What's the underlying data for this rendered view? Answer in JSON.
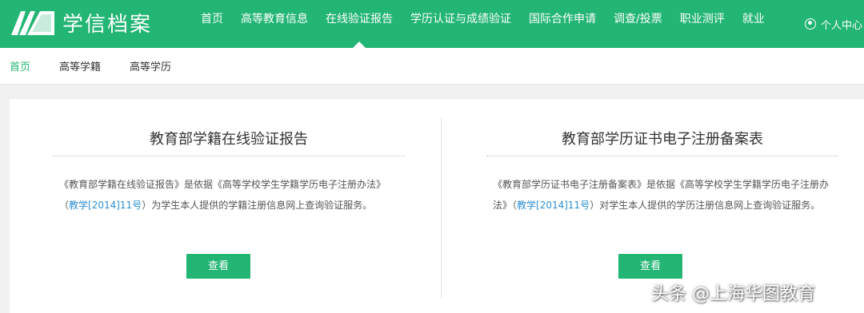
{
  "brand": {
    "name": "学信档案",
    "logo_icon": "book-logo-icon",
    "color": "#22b573"
  },
  "nav": {
    "items": [
      {
        "label": "首页"
      },
      {
        "label": "高等教育信息"
      },
      {
        "label": "在线验证报告",
        "active": true
      },
      {
        "label": "学历认证与成绩验证"
      },
      {
        "label": "国际合作申请"
      },
      {
        "label": "调查/投票"
      },
      {
        "label": "职业测评"
      },
      {
        "label": "就业"
      }
    ],
    "user_center": "个人中心"
  },
  "subnav": {
    "items": [
      {
        "label": "首页",
        "active": true
      },
      {
        "label": "高等学籍"
      },
      {
        "label": "高等学历"
      }
    ]
  },
  "cards": [
    {
      "title": "教育部学籍在线验证报告",
      "desc_before": "《教育部学籍在线验证报告》是依据《高等学校学生学籍学历电子注册办法》（",
      "desc_link": "教学[2014]11号",
      "desc_after": "）为学生本人提供的学籍注册信息网上查询验证服务。",
      "button": "查看"
    },
    {
      "title": "教育部学历证书电子注册备案表",
      "desc_before": "《教育部学历证书电子注册备案表》是依据《高等学校学生学籍学历电子注册办法》（",
      "desc_link": "教学[2014]11号",
      "desc_after": "）对学生本人提供的学历注册信息网上查询验证服务。",
      "button": "查看"
    }
  ],
  "watermark": "头条 @上海华图教育"
}
